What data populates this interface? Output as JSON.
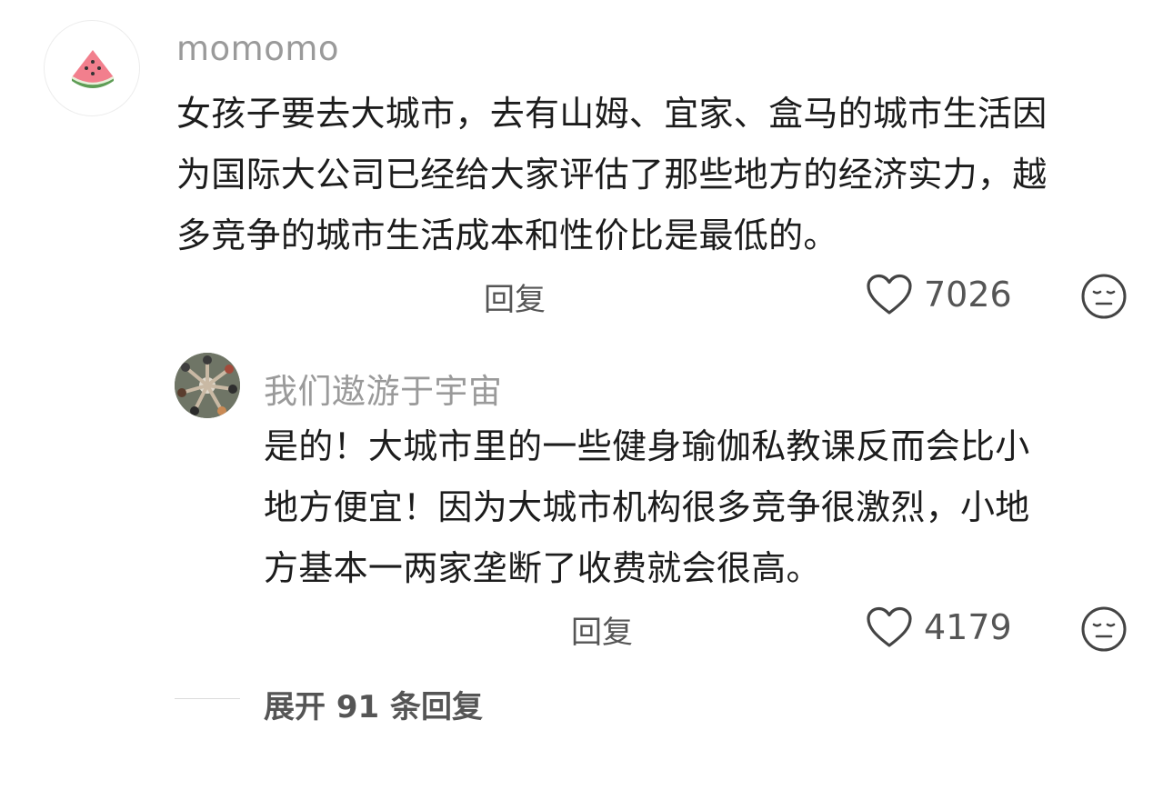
{
  "comment": {
    "username": "momomo",
    "avatar_icon": "watermelon-icon",
    "text_lines": [
      "女孩子要去大城市，去有山姆、宜家、盒马的城市生活因",
      "为国际大公司已经给大家评估了那些地方的经济实力，越",
      "多竞争的城市生活成本和性价比是最低的。"
    ],
    "reply_label": "回复",
    "like_count": "7026"
  },
  "reply": {
    "username": "我们遨游于宇宙",
    "text_lines": [
      "是的！大城市里的一些健身瑜伽私教课反而会比小",
      "地方便宜！因为大城市机构很多竞争很激烈，小地",
      "方基本一两家垄断了收费就会很高。"
    ],
    "reply_label": "回复",
    "like_count": "4179"
  },
  "expand_replies_label": "展开 91 条回复"
}
